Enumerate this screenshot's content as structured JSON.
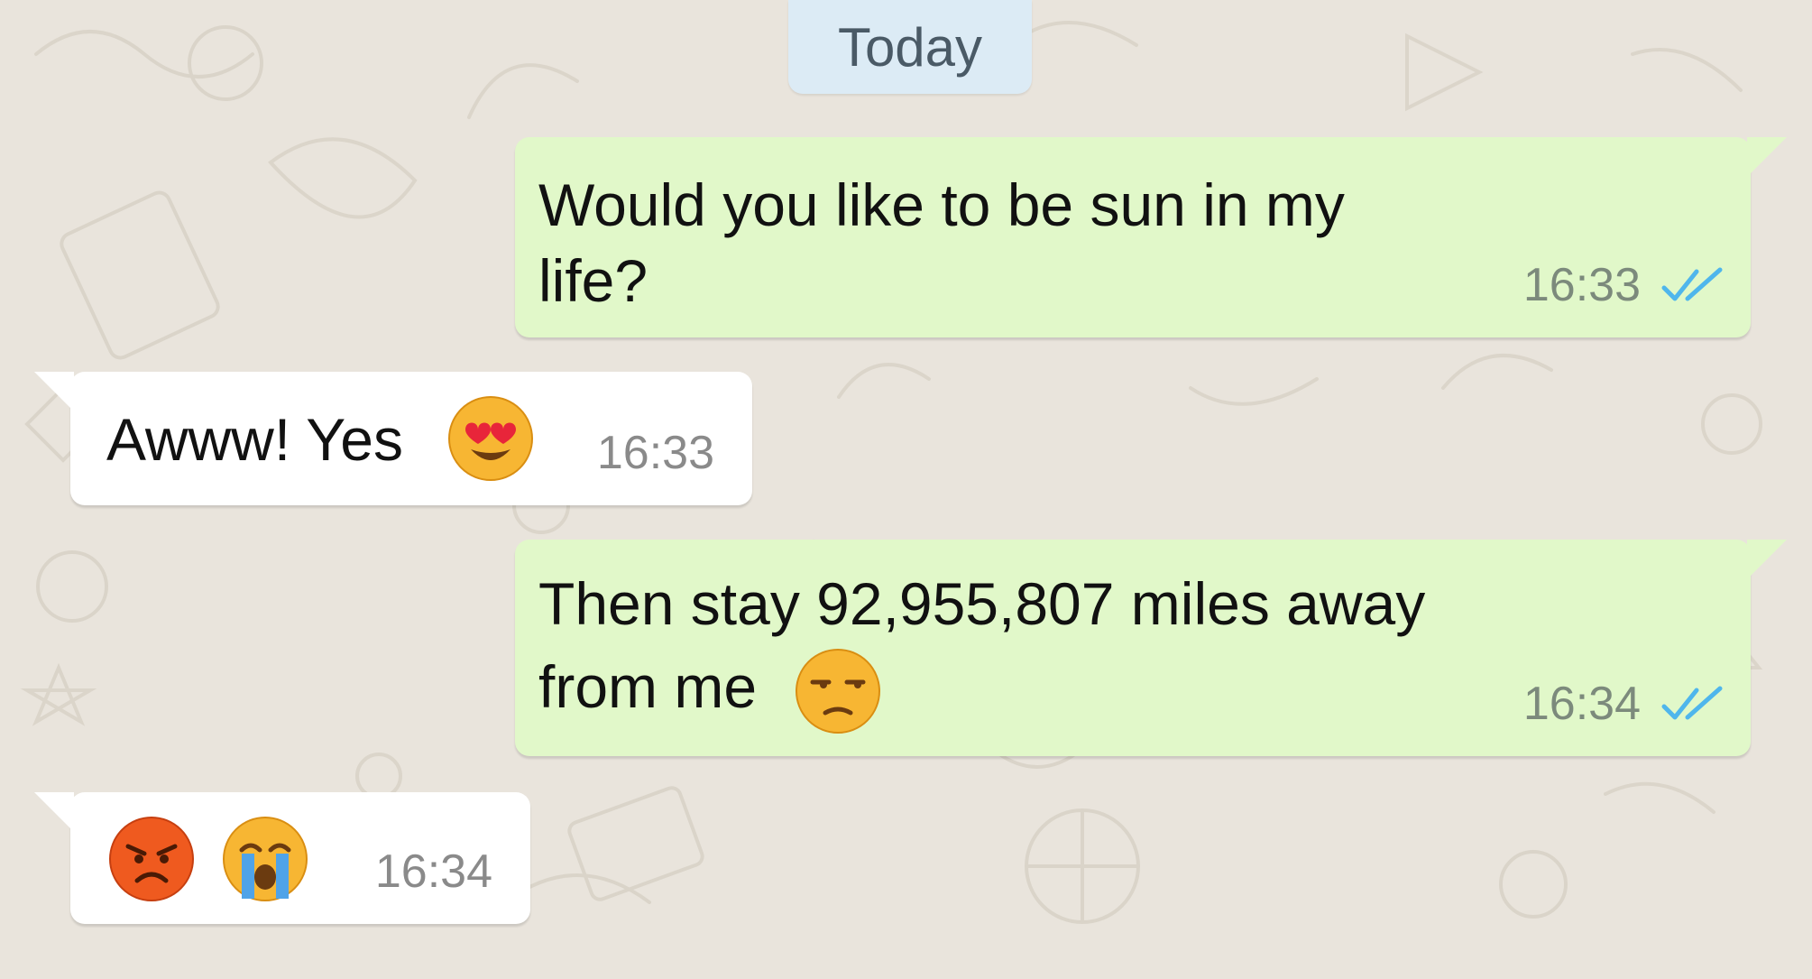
{
  "date_separator": "Today",
  "messages": [
    {
      "direction": "outgoing",
      "text_line1": "Would you like to be sun in my",
      "text_line2": "life?",
      "time": "16:33",
      "status": "read"
    },
    {
      "direction": "incoming",
      "text": "Awww! Yes",
      "emoji": [
        "smiling-face-heart-eyes-emoji"
      ],
      "time": "16:33"
    },
    {
      "direction": "outgoing",
      "text_line1": "Then stay 92,955,807 miles away",
      "text_line2": "from me",
      "emoji": [
        "unamused-face-emoji"
      ],
      "time": "16:34",
      "status": "read"
    },
    {
      "direction": "incoming",
      "text": "",
      "emoji": [
        "angry-face-emoji",
        "loudly-crying-face-emoji"
      ],
      "time": "16:34"
    }
  ],
  "colors": {
    "background": "#e9e4dc",
    "outgoing_bubble": "#e1f8c9",
    "incoming_bubble": "#ffffff",
    "date_chip": "#dcebf5",
    "read_ticks": "#4fb6ec"
  }
}
